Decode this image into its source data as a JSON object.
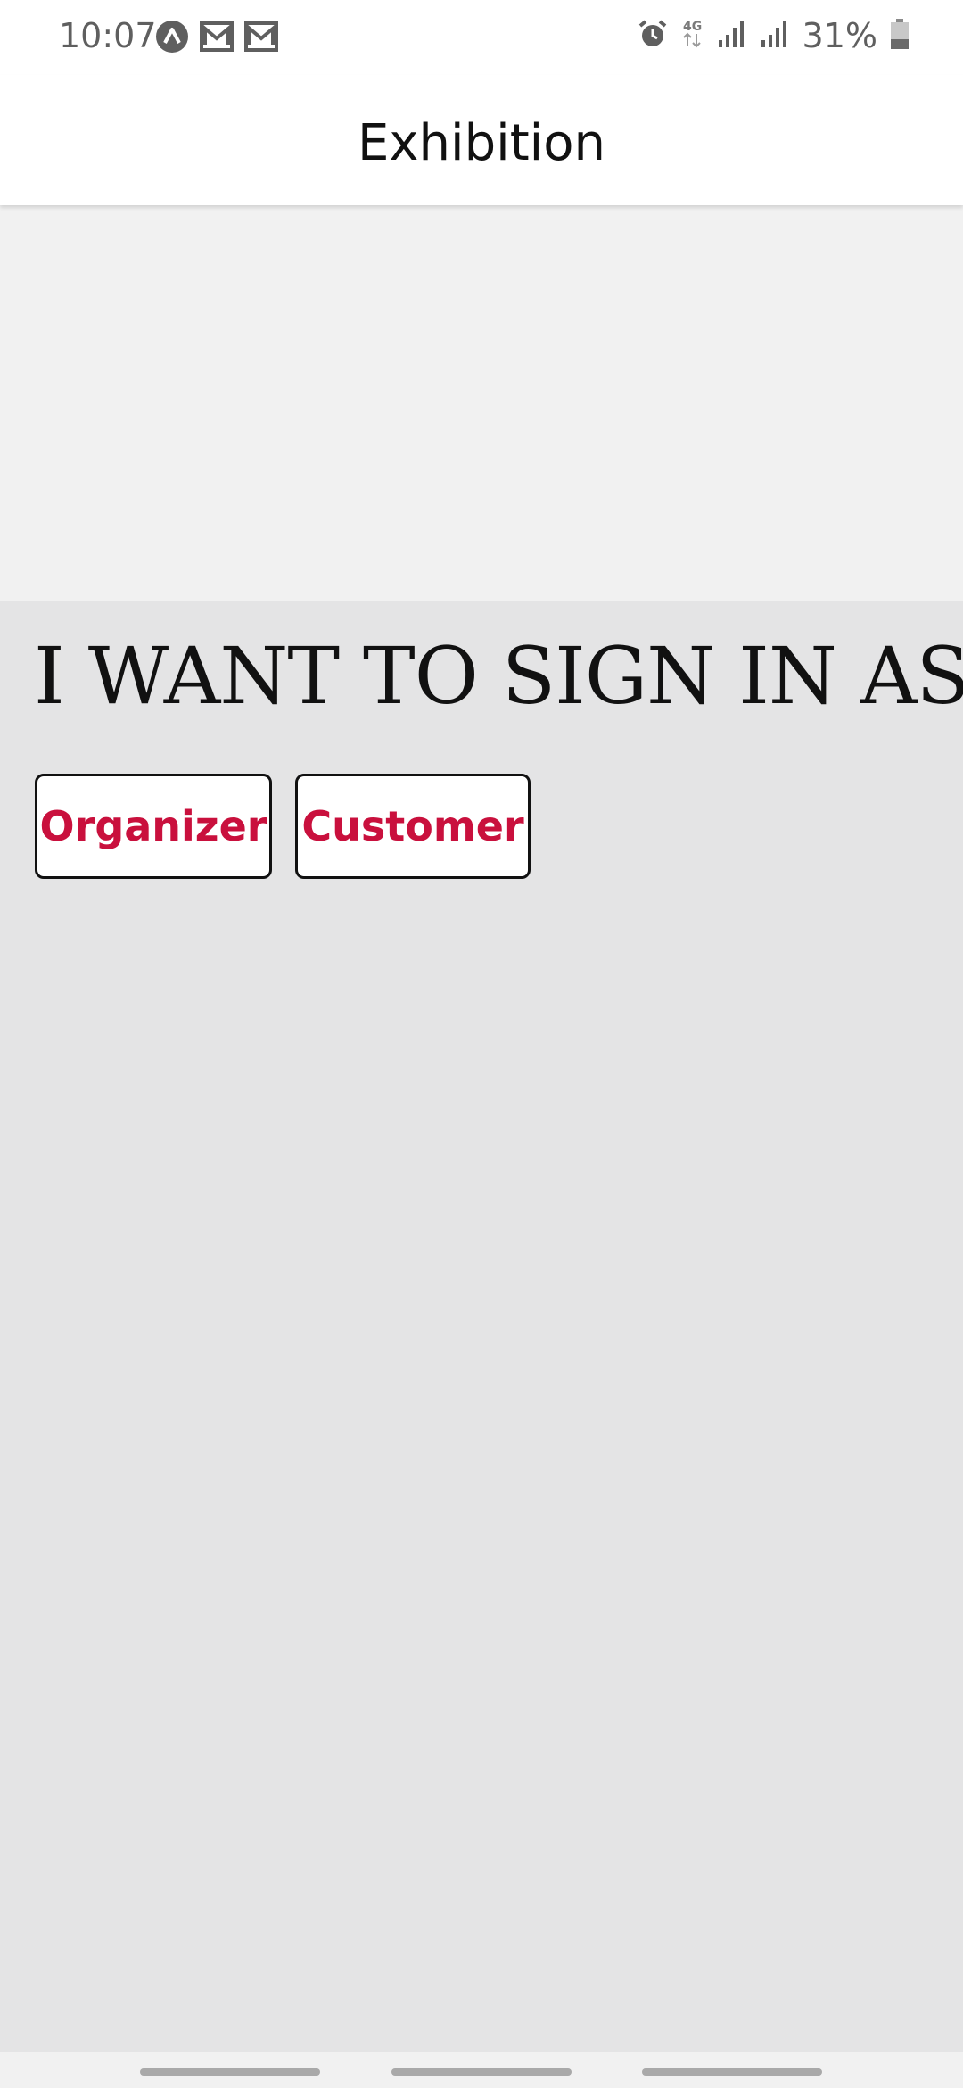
{
  "status_bar": {
    "time": "10:07",
    "left_icons": [
      "arch-icon",
      "gmail-icon",
      "gmail-icon"
    ],
    "right_icons": [
      "alarm-icon",
      "network-4g-icon",
      "signal-icon",
      "signal-icon"
    ],
    "battery_percent": "31%"
  },
  "app_bar": {
    "title": "Exhibition"
  },
  "main": {
    "heading": "I WANT TO SIGN IN AS:",
    "buttons": {
      "organizer": "Organizer",
      "customer": "Customer"
    }
  },
  "colors": {
    "accent": "#c9103d",
    "background": "#e4e4e5",
    "banner": "#f1f1f1"
  }
}
